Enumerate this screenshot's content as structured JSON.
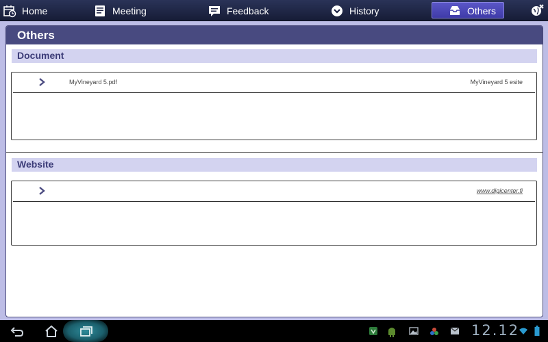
{
  "nav": {
    "items": [
      {
        "label": "Home",
        "icon": "calendar-clock-icon"
      },
      {
        "label": "Meeting",
        "icon": "notebook-icon"
      },
      {
        "label": "Feedback",
        "icon": "speech-bubble-icon"
      },
      {
        "label": "History",
        "icon": "chevron-circle-icon"
      },
      {
        "label": "Others",
        "icon": "inbox-tray-icon"
      }
    ],
    "active": "Others"
  },
  "panel": {
    "title": "Others",
    "sections": {
      "document": {
        "title": "Document",
        "rows": [
          {
            "left": "MyVineyard 5.pdf",
            "right": "MyVineyard 5 esite"
          }
        ]
      },
      "website": {
        "title": "Website",
        "rows": [
          {
            "right": "www.digicenter.fi"
          }
        ]
      }
    }
  },
  "system": {
    "clock": "12.12"
  },
  "colors": {
    "accent": "#484a80",
    "section_bg": "#d3d3f0",
    "active_tab": "#4a46b8"
  }
}
